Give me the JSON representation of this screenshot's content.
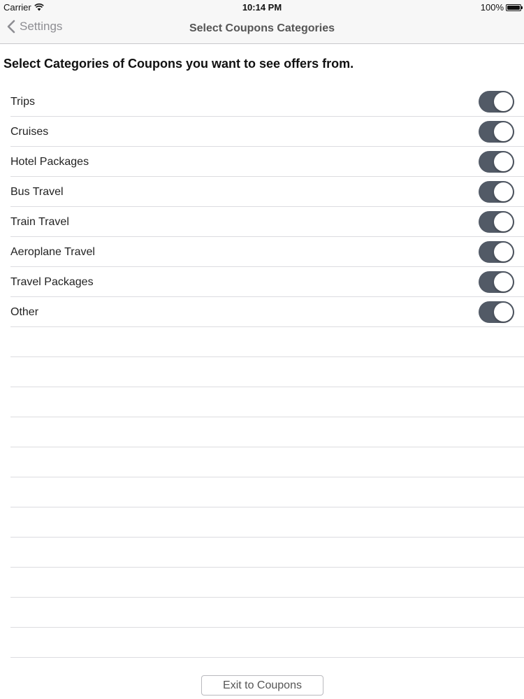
{
  "status_bar": {
    "carrier": "Carrier",
    "time": "10:14 PM",
    "battery": "100%"
  },
  "nav": {
    "back_label": "Settings",
    "title": "Select Coupons Categories"
  },
  "heading": "Select Categories of Coupons you want to see offers from.",
  "categories": [
    {
      "label": "Trips",
      "enabled": true
    },
    {
      "label": "Cruises",
      "enabled": true
    },
    {
      "label": "Hotel Packages",
      "enabled": true
    },
    {
      "label": "Bus Travel",
      "enabled": true
    },
    {
      "label": "Train Travel",
      "enabled": true
    },
    {
      "label": "Aeroplane Travel",
      "enabled": true
    },
    {
      "label": "Travel Packages",
      "enabled": true
    },
    {
      "label": "Other",
      "enabled": true
    }
  ],
  "exit_button_label": "Exit to Coupons",
  "colors": {
    "toggle_on": "#525a66",
    "nav_text": "#8e8e93"
  }
}
